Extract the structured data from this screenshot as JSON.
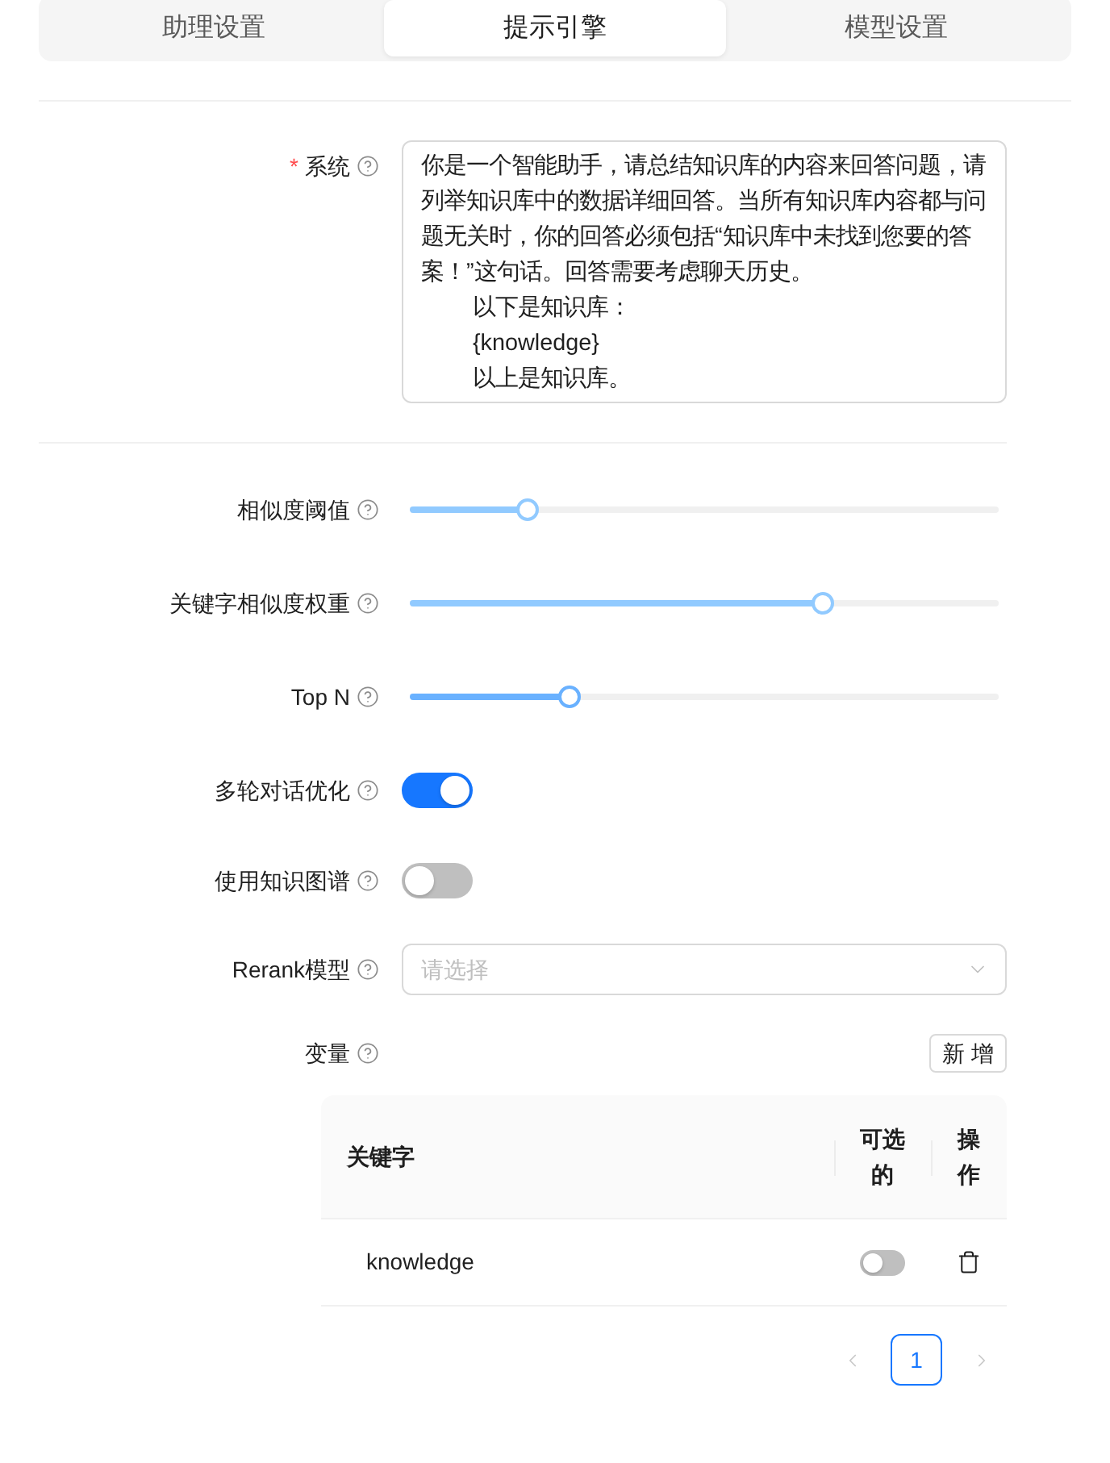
{
  "tabs": [
    {
      "label": "助理设置",
      "selected": false
    },
    {
      "label": "提示引擎",
      "selected": true
    },
    {
      "label": "模型设置",
      "selected": false
    }
  ],
  "system": {
    "label": "系统",
    "required_mark": "*",
    "paragraphs": [
      {
        "text": "你是一个智能助手，请总结知识库的内容来回答问题，请列举知识库中的数据详细回答。当所有知识库内容都与问题无关时，你的回答必须包括“知识库中未找到您要的答案！”这句话。回答需要考虑聊天历史。",
        "indented": false
      },
      {
        "text": "以下是知识库：",
        "indented": true
      },
      {
        "text": "{knowledge}",
        "indented": true
      },
      {
        "text": "以上是知识库。",
        "indented": true
      }
    ]
  },
  "sliders": [
    {
      "label": "相似度阈值",
      "level": 0.2,
      "focused": false
    },
    {
      "label": "关键字相似度权重",
      "level": 0.7,
      "focused": false
    },
    {
      "label": "Top N",
      "level": 0.27,
      "focused": true
    }
  ],
  "switches": [
    {
      "label": "多轮对话优化",
      "on": true
    },
    {
      "label": "使用知识图谱",
      "on": false
    }
  ],
  "rerank": {
    "label": "Rerank模型",
    "placeholder": "请选择"
  },
  "variables": {
    "label": "变量",
    "add_button": "新 增",
    "columns": [
      {
        "label": "关键字"
      },
      {
        "label": "可选的"
      },
      {
        "label": "操作"
      }
    ],
    "rows": [
      {
        "keyword": "knowledge",
        "optional": false
      }
    ],
    "pagination": {
      "prev_disabled": true,
      "next_disabled": true,
      "pages": [
        {
          "label": "1",
          "selected": true
        }
      ]
    }
  }
}
